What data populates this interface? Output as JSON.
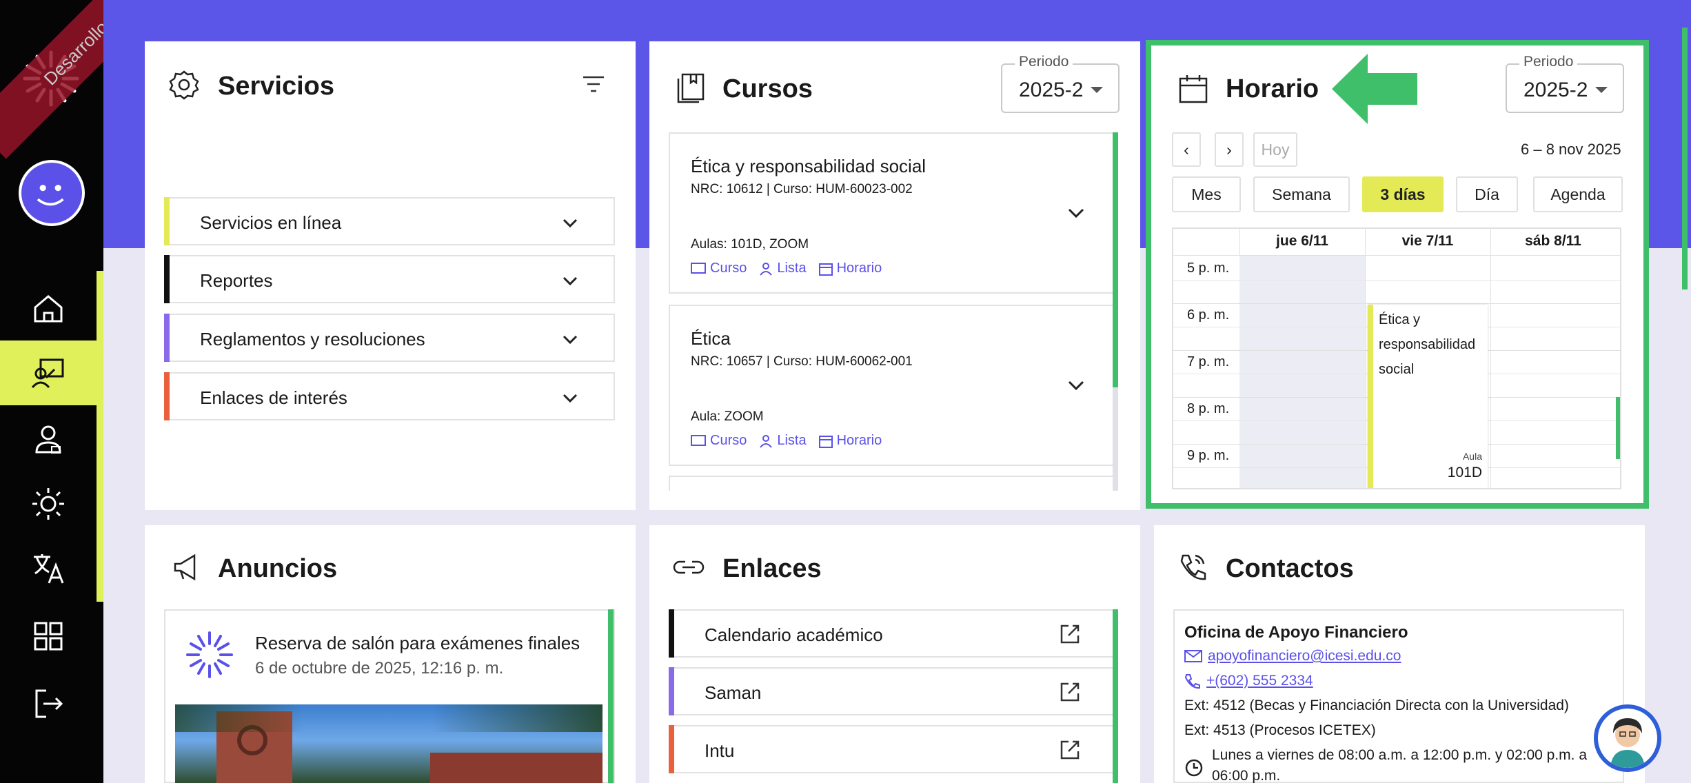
{
  "sidebar": {
    "ribbon_text": "Desarrollo",
    "nav_items": [
      "home-icon",
      "teaching-icon",
      "user-icon",
      "sun-icon",
      "translate-icon",
      "apps-icon",
      "logout-icon"
    ]
  },
  "servicios": {
    "title": "Servicios",
    "items": [
      {
        "label": "Servicios en línea",
        "color": "#e3ea55"
      },
      {
        "label": "Reportes",
        "color": "#111111"
      },
      {
        "label": "Reglamentos y resoluciones",
        "color": "#8a6ae8"
      },
      {
        "label": "Enlaces de interés",
        "color": "#e8603c"
      }
    ]
  },
  "cursos": {
    "title": "Cursos",
    "period_label": "Periodo",
    "period_value": "2025-2",
    "courses": [
      {
        "name": "Ética y responsabilidad social",
        "meta": "NRC: 10612 | Curso: HUM-60023-002",
        "aulas": "Aulas: 101D, ZOOM"
      },
      {
        "name": "Ética",
        "meta": "NRC: 10657 | Curso: HUM-60062-001",
        "aulas": "Aula: ZOOM"
      }
    ],
    "links": {
      "curso": "Curso",
      "lista": "Lista",
      "horario": "Horario"
    }
  },
  "horario": {
    "title": "Horario",
    "period_label": "Periodo",
    "period_value": "2025-2",
    "today": "Hoy",
    "prev": "‹",
    "next": "›",
    "range": "6 – 8 nov 2025",
    "views": [
      "Mes",
      "Semana",
      "3 días",
      "Día",
      "Agenda"
    ],
    "active_view": "3 días",
    "days": [
      "jue 6/11",
      "vie 7/11",
      "sáb 8/11"
    ],
    "times": [
      "5 p. m.",
      "6 p. m.",
      "7 p. m.",
      "8 p. m.",
      "9 p. m."
    ],
    "event": {
      "title": "Ética y responsabilidad social",
      "aula_label": "Aula",
      "aula": "101D"
    }
  },
  "anuncios": {
    "title": "Anuncios",
    "item_title": "Reserva de salón para exámenes finales",
    "item_date": "6 de octubre de 2025, 12:16 p. m."
  },
  "enlaces": {
    "title": "Enlaces",
    "items": [
      {
        "label": "Calendario académico",
        "color": "#111111"
      },
      {
        "label": "Saman",
        "color": "#8a6ae8"
      },
      {
        "label": "Intu",
        "color": "#e8603c"
      }
    ]
  },
  "contactos": {
    "title": "Contactos",
    "office": "Oficina de Apoyo Financiero",
    "email": "apoyofinanciero@icesi.edu.co",
    "phone": "+(602) 555 2334",
    "ext1": "Ext: 4512 (Becas y Financiación Directa con la Universidad)",
    "ext2": "Ext: 4513 (Procesos ICETEX)",
    "hours": "Lunes a viernes de 08:00 a.m. a 12:00 p.m. y 02:00 p.m. a",
    "hours2": "06:00 p.m."
  },
  "colors": {
    "brand": "#5b55e8",
    "accent_green": "#3fbf6a",
    "accent_yellow": "#dff05a"
  }
}
